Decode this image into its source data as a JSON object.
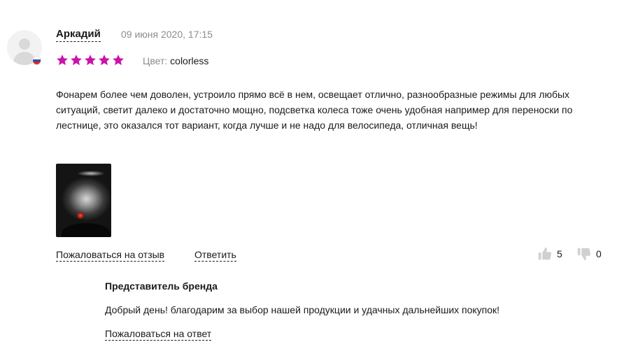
{
  "review": {
    "author": "Аркадий",
    "date": "09 июня 2020, 17:15",
    "rating": 5,
    "rating_max": 5,
    "color_label": "Цвет:",
    "color_value": "colorless",
    "text": "Фонарем более чем доволен, устроило прямо всё в нем, освещает отлично, разнообразные режимы для любых ситуаций, светит далеко и достаточно мощно, подсветка колеса тоже очень удобная например для переноски по лестнице, это оказался тот вариант, когда лучше и не надо для велосипеда, отличная вещь!",
    "complain_label": "Пожаловаться на отзыв",
    "reply_label": "Ответить",
    "likes": "5",
    "dislikes": "0"
  },
  "brand_reply": {
    "title": "Представитель бренда",
    "text": "Добрый день! благодарим за выбор нашей продукции и удачных дальнейших покупок!",
    "complain_label": "Пожаловаться на ответ"
  },
  "colors": {
    "star": "#cb11ab",
    "text": "#1a1a1a",
    "muted": "#8c8c8c",
    "vote_icon": "#d0d0d0"
  },
  "icons": {
    "avatar": "user-placeholder-icon",
    "flag": "russia-flag-icon",
    "star": "star-icon",
    "like": "thumbs-up-icon",
    "dislike": "thumbs-down-icon"
  }
}
